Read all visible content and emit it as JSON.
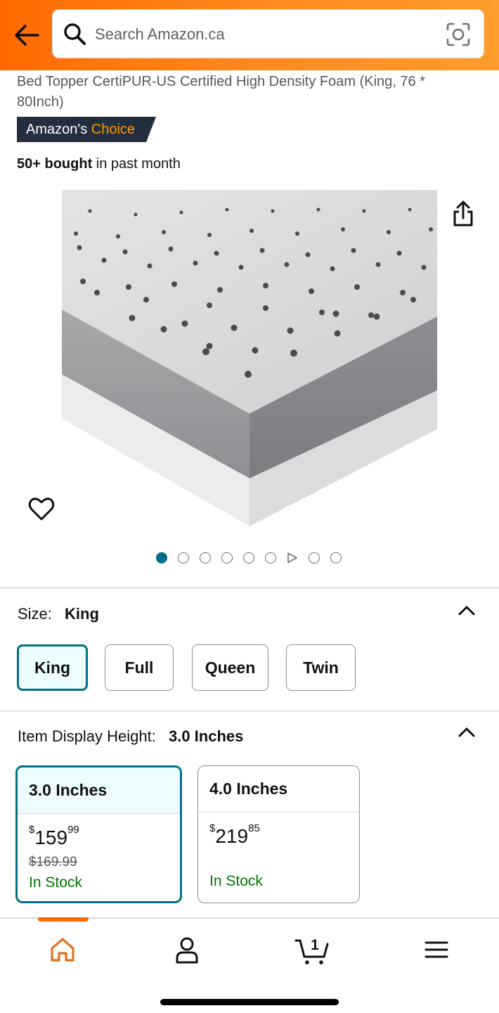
{
  "header": {
    "search_placeholder": "Search Amazon.ca",
    "icons": [
      "back-arrow-icon",
      "search-icon",
      "camera-lens-icon"
    ]
  },
  "product": {
    "title": "Bed Topper CertiPUR-US Certified High Density Foam (King, 76 * 80Inch)",
    "badge_prefix": "Amazon's",
    "badge_suffix": "Choice",
    "bought_bold": "50+ bought",
    "bought_rest": "in past month",
    "image_count": 9,
    "active_image_index": 0
  },
  "size": {
    "label": "Size:",
    "selected": "King",
    "options": [
      "King",
      "Full",
      "Queen",
      "Twin"
    ]
  },
  "height": {
    "label": "Item Display Height:",
    "selected": "3.0 Inches",
    "options": [
      {
        "label": "3.0 Inches",
        "price_whole": "159",
        "price_fraction": "99",
        "currency": "$",
        "list_price": "$169.99",
        "stock": "In Stock"
      },
      {
        "label": "4.0 Inches",
        "price_whole": "219",
        "price_fraction": "85",
        "currency": "$",
        "list_price": "",
        "stock": "In Stock"
      }
    ]
  },
  "bottom_nav": {
    "cart_count": "1",
    "items": [
      "home-icon",
      "account-icon",
      "cart-icon",
      "menu-icon"
    ]
  },
  "colors": {
    "header_orange": "#ff6a00",
    "badge_navy": "#232f3e",
    "badge_choice": "#ff9900",
    "selected_teal": "#007185",
    "in_stock_green": "#007600"
  }
}
